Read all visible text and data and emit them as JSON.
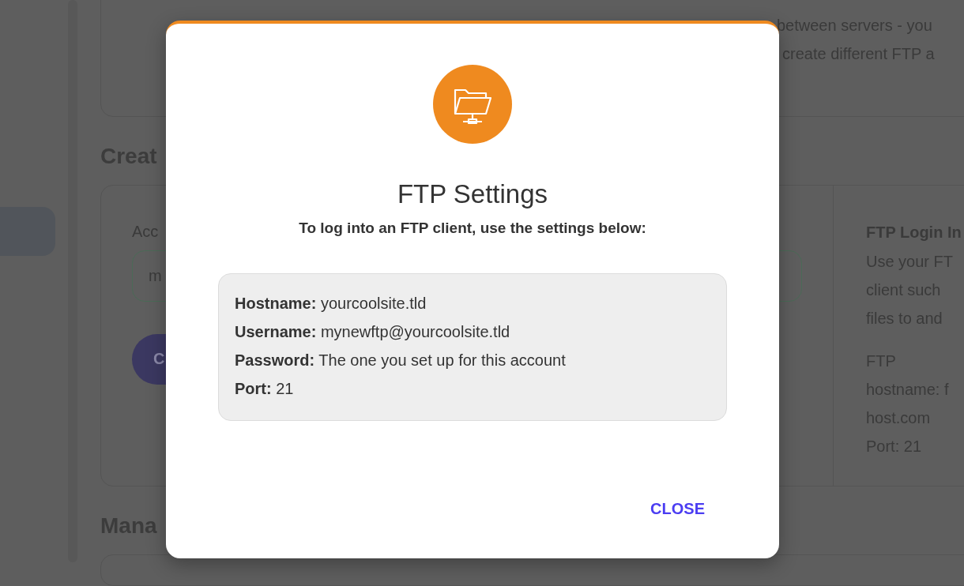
{
  "background": {
    "intro_card": {
      "lines": [
        "between servers - you",
        "create different FTP a"
      ]
    },
    "create_section": {
      "heading": "Creat",
      "field_label": "Acc",
      "field_value": "m",
      "button_label": "C",
      "info": {
        "title": "FTP Login In",
        "lines": [
          "Use your FT",
          "client such",
          "files to and"
        ],
        "details": [
          "FTP",
          "hostname: f",
          "host.com",
          "Port: 21"
        ]
      }
    },
    "manage_section": {
      "heading": "Mana"
    }
  },
  "dialog": {
    "title": "FTP Settings",
    "subtitle": "To log into an FTP client, use the settings below:",
    "settings": [
      "**Hostname:** yourcoolsite.tld",
      "**Username:** mynewftp@yourcoolsite.tld",
      "**Password:** The one you set up for this account",
      "**Port:** 21"
    ],
    "close_button": "CLOSE"
  }
}
